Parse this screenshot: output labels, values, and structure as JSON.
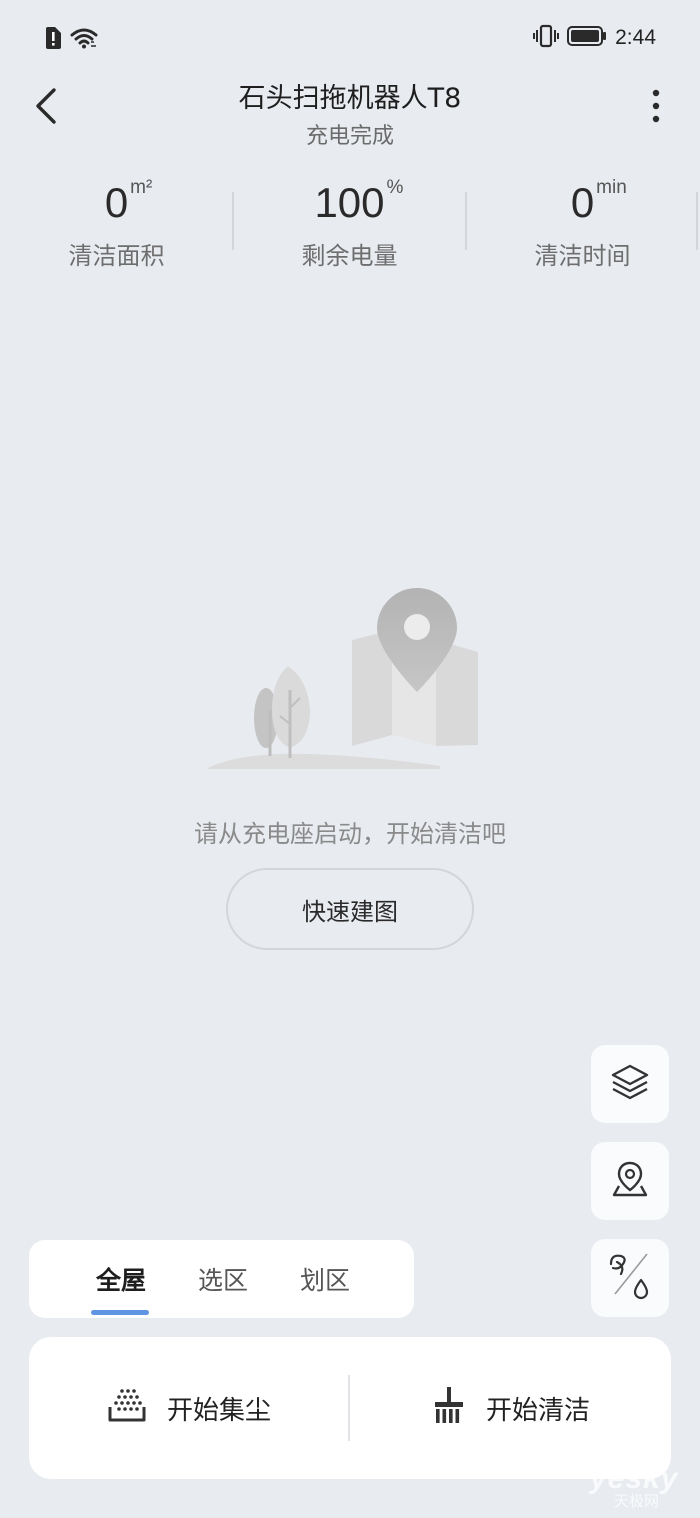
{
  "status_bar": {
    "time": "2:44"
  },
  "header": {
    "title": "石头扫拖机器人T8",
    "subtitle": "充电完成"
  },
  "stats": [
    {
      "value": "0",
      "unit": "m²",
      "label": "清洁面积"
    },
    {
      "value": "100",
      "unit": "%",
      "label": "剩余电量"
    },
    {
      "value": "0",
      "unit": "min",
      "label": "清洁时间"
    }
  ],
  "empty_state": {
    "message": "请从充电座启动，开始清洁吧",
    "button_label": "快速建图"
  },
  "mode_tabs": [
    {
      "label": "全屋",
      "active": true
    },
    {
      "label": "选区",
      "active": false
    },
    {
      "label": "划区",
      "active": false
    }
  ],
  "actions": {
    "dust_label": "开始集尘",
    "clean_label": "开始清洁"
  },
  "watermark": {
    "main": "yesky",
    "sub": "天极网"
  },
  "colors": {
    "background": "#e8ebf0",
    "accent": "#5f95e2",
    "card": "#ffffff"
  },
  "icons": {
    "status_left": [
      "sim-alert-icon",
      "wifi-icon"
    ],
    "status_right": [
      "vibrate-icon",
      "battery-icon"
    ],
    "float_buttons": [
      "layers-icon",
      "location-pin-icon",
      "fan-water-icon"
    ]
  }
}
